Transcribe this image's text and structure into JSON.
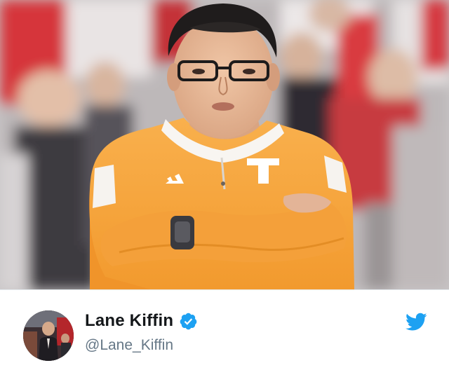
{
  "tweet": {
    "author": {
      "display_name": "Lane Kiffin",
      "handle": "@Lane_Kiffin",
      "verified": true,
      "verified_icon": "verified-check-icon"
    },
    "media": {
      "type": "photo"
    },
    "brand_icon": "twitter-bird-icon"
  },
  "colors": {
    "name_text": "#14171a",
    "handle_text": "#657786",
    "brand_blue": "#1da1f2",
    "jacket_orange": "#f7a23b"
  }
}
